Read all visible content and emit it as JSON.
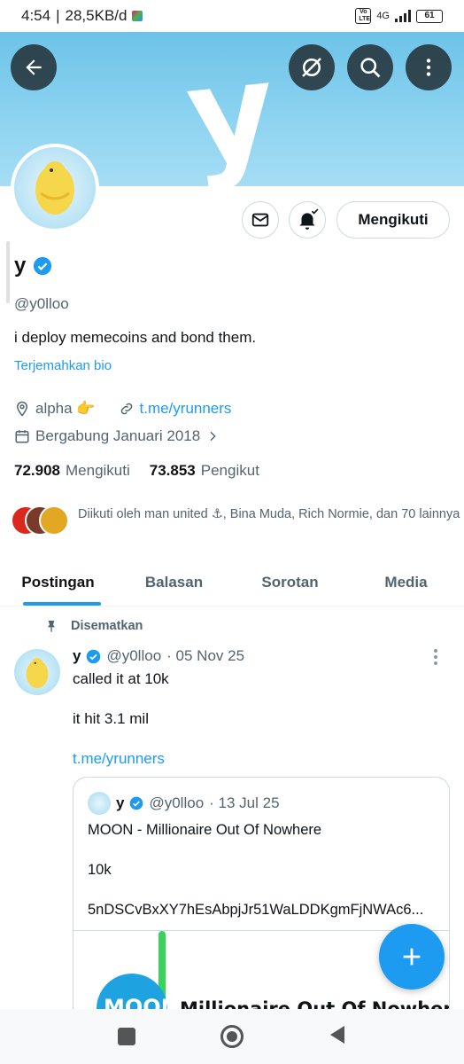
{
  "status_bar": {
    "time": "4:54",
    "network_speed": "28,5KB/d",
    "volte": "Vo LTE",
    "network_type": "4G",
    "battery": "61"
  },
  "banner": {
    "letter": "y",
    "colors": {
      "sky": "#8fd4f1"
    }
  },
  "header_buttons": {
    "back": "back-arrow",
    "hide": "eye-off",
    "search": "search",
    "more": "more-vertical"
  },
  "profile": {
    "display_name": "y",
    "verified": true,
    "handle": "@y0lloo",
    "bio": "i deploy memecoins and bond them.",
    "translate_label": "Terjemahkan bio",
    "location": "alpha 👉",
    "website": "t.me/yrunners",
    "joined": "Bergabung Januari 2018",
    "following_count": "72.908",
    "following_label": "Mengikuti",
    "followers_count": "73.853",
    "followers_label": "Pengikut",
    "followed_by": "Diikuti oleh man united ⚓, Bina Muda, Rich Normie, dan 70 lainnya",
    "follow_button": "Mengikuti"
  },
  "tabs": [
    {
      "label": "Postingan",
      "active": true
    },
    {
      "label": "Balasan",
      "active": false
    },
    {
      "label": "Sorotan",
      "active": false
    },
    {
      "label": "Media",
      "active": false
    }
  ],
  "pinned_post": {
    "pinned_label": "Disematkan",
    "author_name": "y",
    "author_handle": "@y0lloo",
    "date": "· 05 Nov 25",
    "lines": [
      "called it at 10k",
      "it hit 3.1 mil"
    ],
    "link": "t.me/yrunners",
    "quote": {
      "author_name": "y",
      "author_handle": "@y0lloo",
      "date": "· 13 Jul 25",
      "line1": "MOON - Millionaire Out Of Nowhere",
      "line2": "10k",
      "line3": "5nDSCvBxXY7hEsAbpjJr51WaLDDKgmFjNWAc6...",
      "media_label_left": "MOON",
      "media_title": "Millionaire Out Of Nowhere"
    }
  },
  "colors": {
    "accent": "#1d9bf0",
    "text": "#0f1419",
    "muted": "#536471"
  }
}
